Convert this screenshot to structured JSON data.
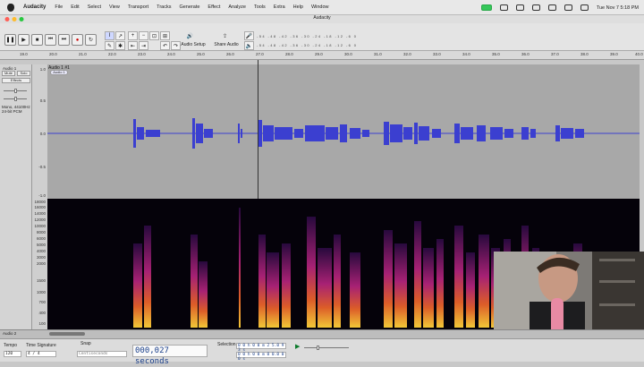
{
  "menubar": {
    "app": "Audacity",
    "items": [
      "File",
      "Edit",
      "Select",
      "View",
      "Transport",
      "Tracks",
      "Generate",
      "Effect",
      "Analyze",
      "Tools",
      "Extra",
      "Help",
      "Window"
    ],
    "clock": "Tue Nov 7  5:18 PM"
  },
  "window": {
    "title": "Audacity"
  },
  "toolbar": {
    "audio_setup": "Audio Setup",
    "share_audio": "Share Audio",
    "meter_marks": "-54 -48 -42 -36 -30 -24 -18 -12 -6 0",
    "meter_marks2": "-54 -48 -42 -36 -30 -24 -18 -12 -6 0"
  },
  "ruler": {
    "labels": [
      "19.0",
      "20.0",
      "21.0",
      "22.0",
      "23.0",
      "24.0",
      "25.0",
      "26.0",
      "27.0",
      "28.0",
      "29.0",
      "30.0",
      "31.0",
      "32.0",
      "33.0",
      "34.0",
      "35.0",
      "36.0",
      "37.0",
      "38.0",
      "39.0",
      "40.0"
    ]
  },
  "track": {
    "panel_name": "Audio 1",
    "header": "Audio 1 #1",
    "clip_label": "Audio 1",
    "mute": "Mute",
    "solo": "Solo",
    "effects": "Effects",
    "info": "Mono, 44100Hz\n24-bit PCM",
    "wave_axis": [
      "1.0",
      "0.5",
      "0.0",
      "-0.5",
      "-1.0"
    ],
    "spec_axis": [
      "18000",
      "16000",
      "14000",
      "12000",
      "10000",
      "8000",
      "6000",
      "5000",
      "4000",
      "3000",
      "2000",
      "1500",
      "1000",
      "700",
      "400",
      "100"
    ],
    "track2_label": "Audio 2"
  },
  "bottom": {
    "tempo_label": "Tempo",
    "tempo_value": "120",
    "timesig_label": "Time Signature",
    "timesig_value": "4 / 4",
    "snap_label": "Snap",
    "snap_value": "Centiseconds",
    "time_display": "000,027 seconds",
    "selection_label": "Selection",
    "sel_start": "0 0 h 0 0 m 2 5.0 9 3 s",
    "sel_end": "0 0 h 0 0 m 0 0.0 0 0 s"
  },
  "colors": {
    "waveform": "#3b3fd0",
    "wave_bg": "#a8a8a8",
    "spec_bg": "#05020a",
    "time_text": "#1a3f8a"
  }
}
